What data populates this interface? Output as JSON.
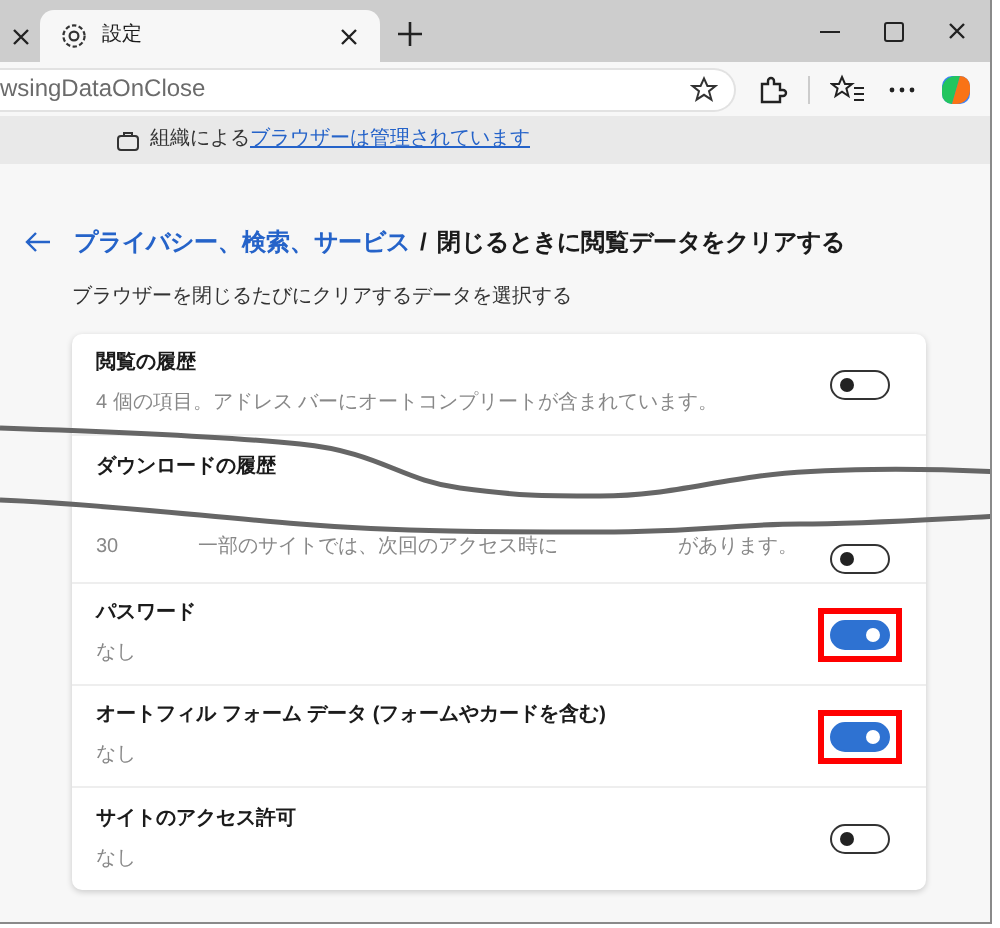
{
  "tabs": [
    {
      "label": "設定",
      "selected": true
    }
  ],
  "address_bar": {
    "value": "wsingDataOnClose"
  },
  "managed_notice": {
    "text": "組織による",
    "link": "ブラウザーは管理されています"
  },
  "breadcrumb": {
    "parent": "プライバシー、検索、サービス",
    "separator": "/",
    "title": "閉じるときに閲覧データをクリアする"
  },
  "subtitle": "ブラウザーを閉じるたびにクリアするデータを選択する",
  "items": [
    {
      "label": "閲覧の履歴",
      "description": [
        "4 個の項目。アドレス バーにオートコンプリートが含まれています。"
      ],
      "on": false,
      "highlighted": false
    },
    {
      "label": "ダウンロードの履歴",
      "description": [
        "30",
        "一部のサイトでは、次回のアクセス時に",
        "があります。"
      ],
      "on": false,
      "highlighted": false
    },
    {
      "label": "パスワード",
      "description": [
        "なし"
      ],
      "on": true,
      "highlighted": true
    },
    {
      "label": "オートフィル フォーム データ (フォームやカードを含む)",
      "description": [
        "なし"
      ],
      "on": true,
      "highlighted": true
    },
    {
      "label": "サイトのアクセス許可",
      "description": [
        "なし"
      ],
      "on": false,
      "highlighted": false
    }
  ]
}
